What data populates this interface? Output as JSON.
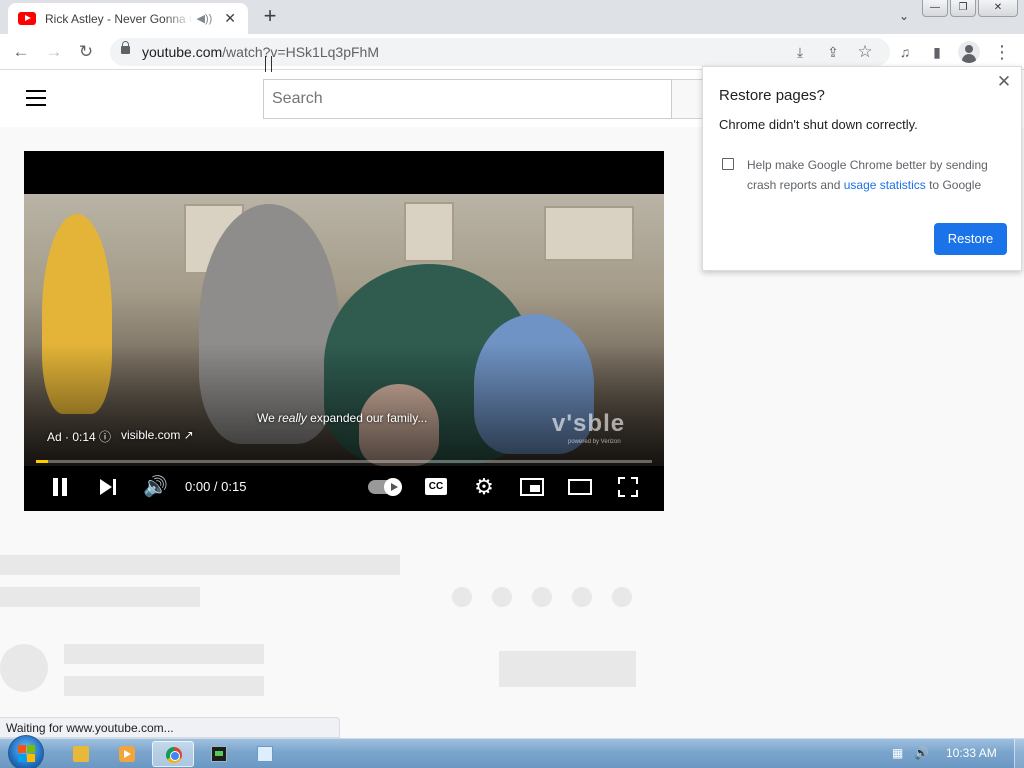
{
  "browser": {
    "tab_title": "Rick Astley - Never Gonna Give You Up",
    "tab_audio_icon": "speaker-icon",
    "tab_close": "✕",
    "new_tab": "+",
    "tab_search": "⌄",
    "window_controls": {
      "minimize": "—",
      "maximize": "❐",
      "close": "✕"
    },
    "nav": {
      "back": "←",
      "forward": "→",
      "reload": "↻"
    },
    "url_host": "youtube.com",
    "url_path": "/watch?v=HSk1Lq3pFhM",
    "omnibox_icons": {
      "install": "⤓",
      "share": "⇪",
      "bookmark": "☆"
    },
    "toolbar_icons": {
      "media": "♫",
      "side_panel": "▮",
      "menu": "⋮"
    }
  },
  "youtube": {
    "search_placeholder": "Search",
    "ad": {
      "caption_pre": "We ",
      "caption_em": "really",
      "caption_post": " expanded our family...",
      "label": "Ad · 0:14 ⓘ",
      "link": "visible.com ↗",
      "brand": "v'sble",
      "brand_sub": "powered by Verizon",
      "progress": 0.02,
      "progress_color": "#ffcc00"
    },
    "controls": {
      "volume": "🔊",
      "time": "0:00 / 0:15",
      "cc": "CC",
      "settings": "⚙"
    }
  },
  "dialog": {
    "title": "Restore pages?",
    "close": "✕",
    "message": "Chrome didn't shut down correctly.",
    "checkbox_pre": "Help make Google Chrome better by sending crash reports and ",
    "checkbox_link": "usage statistics",
    "checkbox_post": " to Google",
    "checked": false,
    "restore_label": "Restore",
    "accent": "#1a73e8"
  },
  "status_bar": "Waiting for www.youtube.com...",
  "taskbar": {
    "apps": [
      "folder-icon",
      "media-player-icon",
      "chrome-icon",
      "command-prompt-icon",
      "notepad-icon"
    ],
    "active_app": "chrome-icon",
    "tray": {
      "network": "▦",
      "volume": "🔊"
    },
    "clock": "10:33 AM"
  }
}
